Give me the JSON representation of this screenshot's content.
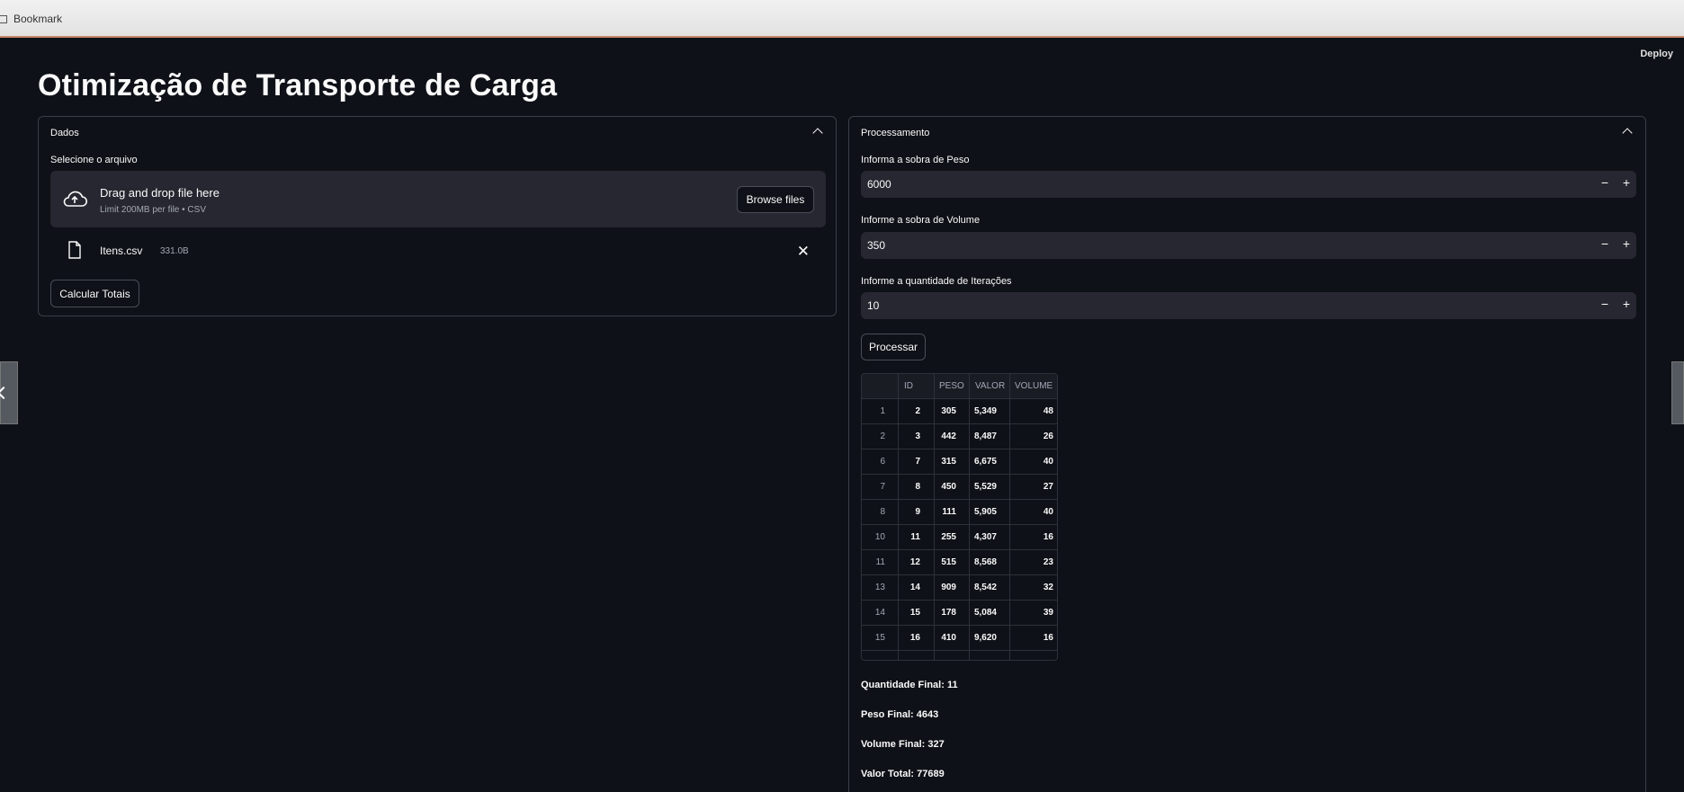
{
  "browser": {
    "bookmark_label": "Bookmark"
  },
  "app": {
    "deploy_label": "Deploy",
    "title": "Otimização de Transporte de Carga"
  },
  "dados": {
    "header": "Dados",
    "select_label": "Selecione o arquivo",
    "dropzone_title": "Drag and drop file here",
    "dropzone_sub": "Limit 200MB per file • CSV",
    "browse_label": "Browse files",
    "file_name": "Itens.csv",
    "file_size": "331.0B",
    "calc_label": "Calcular Totais"
  },
  "processamento": {
    "header": "Processamento",
    "peso_label": "Informa a sobra de Peso",
    "peso_value": "6000",
    "volume_label": "Informe a sobra de Volume",
    "volume_value": "350",
    "iter_label": "Informe a quantidade de Iterações",
    "iter_value": "10",
    "process_label": "Processar"
  },
  "table": {
    "columns": [
      "",
      "ID",
      "PESO",
      "VALOR",
      "VOLUME"
    ],
    "rows": [
      [
        "1",
        "2",
        "305",
        "5,349",
        "48"
      ],
      [
        "2",
        "3",
        "442",
        "8,487",
        "26"
      ],
      [
        "6",
        "7",
        "315",
        "6,675",
        "40"
      ],
      [
        "7",
        "8",
        "450",
        "5,529",
        "27"
      ],
      [
        "8",
        "9",
        "111",
        "5,905",
        "40"
      ],
      [
        "10",
        "11",
        "255",
        "4,307",
        "16"
      ],
      [
        "11",
        "12",
        "515",
        "8,568",
        "23"
      ],
      [
        "13",
        "14",
        "909",
        "8,542",
        "32"
      ],
      [
        "14",
        "15",
        "178",
        "5,084",
        "39"
      ],
      [
        "15",
        "16",
        "410",
        "9,620",
        "16"
      ]
    ]
  },
  "summary": {
    "quantidade": "Quantidade Final: 11",
    "peso": "Peso Final: 4643",
    "volume": "Volume Final: 327",
    "valor": "Valor Total: 77689"
  }
}
